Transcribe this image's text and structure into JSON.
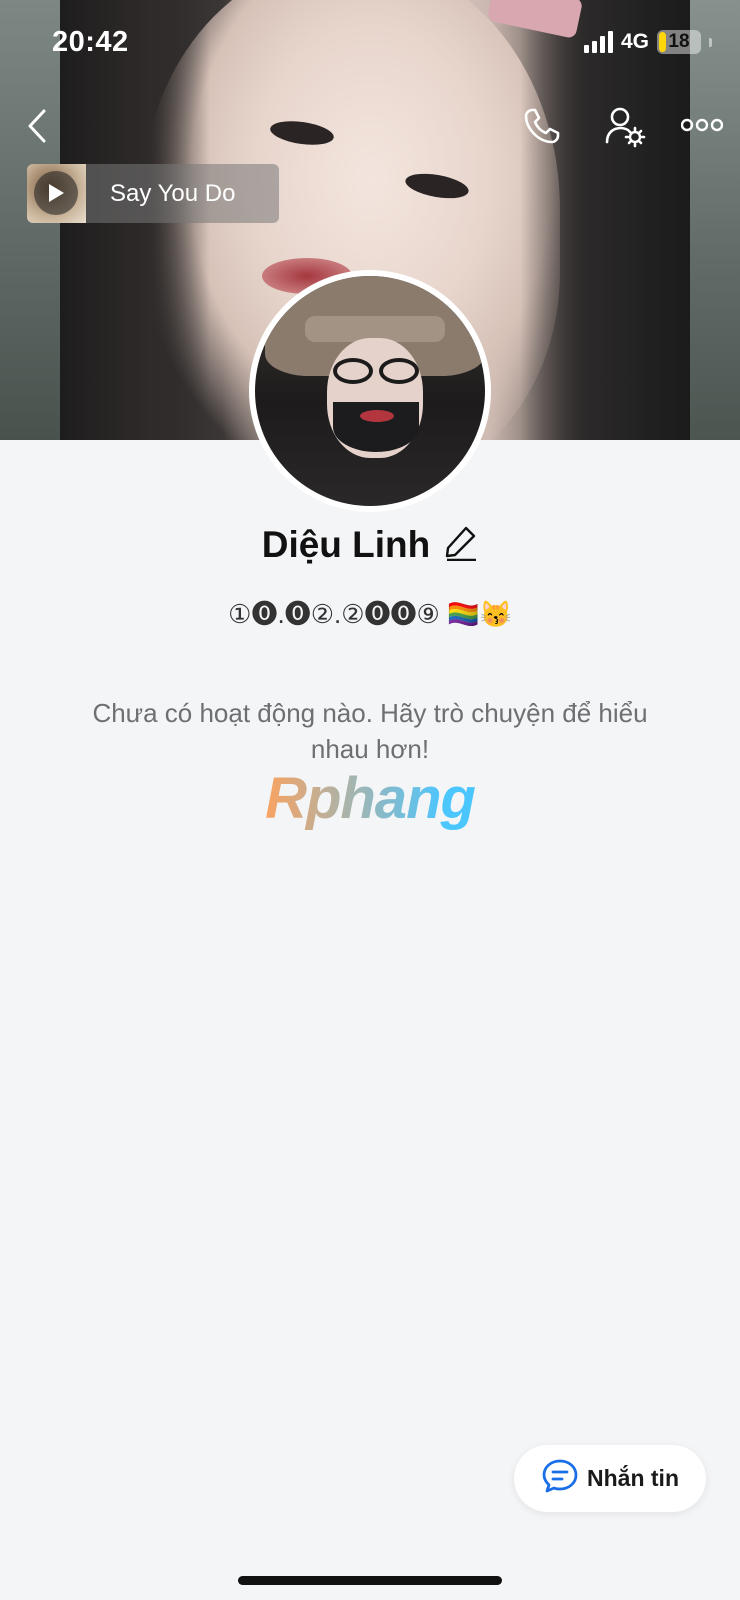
{
  "status_bar": {
    "time": "20:42",
    "network": "4G",
    "battery": "18",
    "battery_level_percent": 18
  },
  "music": {
    "title": "Say You Do"
  },
  "profile": {
    "name": "Diệu Linh",
    "bio": "①⓿.⓿②.②⓿⓿⑨ 🏳️‍🌈😽"
  },
  "empty_state": {
    "message": "Chưa có hoạt động nào. Hãy trò chuyện để hiểu nhau hơn!"
  },
  "watermark": {
    "text": "Rphang"
  },
  "actions": {
    "message_label": "Nhắn tin"
  },
  "colors": {
    "accent": "#1a6fe8",
    "background": "#f4f5f7",
    "battery_low": "#ffd60a"
  },
  "icons": {
    "back": "back-chevron-icon",
    "call": "phone-icon",
    "settings": "user-settings-icon",
    "more": "more-dots-icon",
    "play": "play-icon",
    "edit": "pencil-icon",
    "chat": "chat-bubble-icon"
  }
}
